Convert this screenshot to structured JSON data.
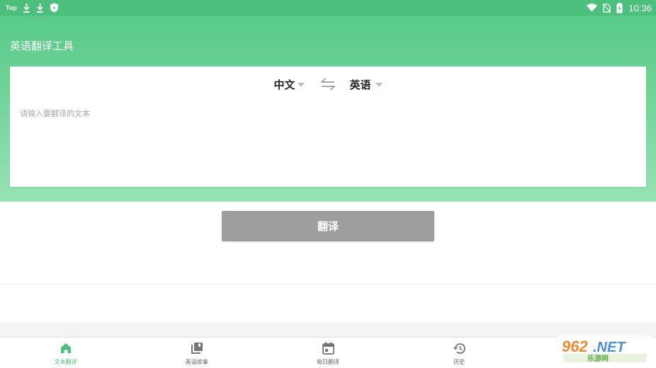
{
  "status_bar": {
    "carrier": "Tup",
    "time": "10:36",
    "icons": [
      "download-icon",
      "download-icon",
      "shield-icon",
      "wifi-icon",
      "no-sim-icon",
      "battery-charging-icon"
    ]
  },
  "app": {
    "title": "英语翻译工具"
  },
  "translator": {
    "source_lang": "中文",
    "target_lang": "英语",
    "swap_icon": "swap-icon",
    "input_placeholder": "请输入要翻译的文本",
    "input_value": ""
  },
  "translate_button": {
    "label": "翻译"
  },
  "bottom_nav": {
    "items": [
      {
        "label": "文本翻译",
        "icon": "home-icon",
        "active": true
      },
      {
        "label": "英语故事",
        "icon": "library-icon",
        "active": false
      },
      {
        "label": "每日翻译",
        "icon": "calendar-icon",
        "active": false
      },
      {
        "label": "历史",
        "icon": "history-icon",
        "active": false
      }
    ]
  },
  "watermark": {
    "logo_text": "962.NET",
    "sub_text": "乐游网"
  },
  "colors": {
    "primary": "#4cbf7c",
    "button_disabled": "#9e9e9e",
    "nav_inactive": "#666666"
  }
}
